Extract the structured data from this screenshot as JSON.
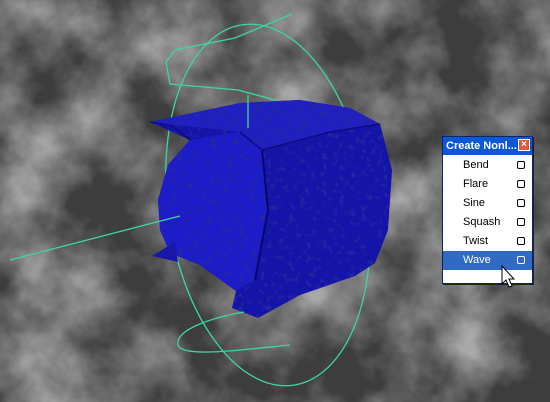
{
  "menu": {
    "title": "Create Nonl...",
    "close_icon": "close-icon",
    "items": [
      {
        "label": "Bend",
        "option_icon": "option-box-icon"
      },
      {
        "label": "Flare",
        "option_icon": "option-box-icon"
      },
      {
        "label": "Sine",
        "option_icon": "option-box-icon"
      },
      {
        "label": "Squash",
        "option_icon": "option-box-icon"
      },
      {
        "label": "Twist",
        "option_icon": "option-box-icon"
      },
      {
        "label": "Wave",
        "option_icon": "option-box-icon",
        "selected": true
      }
    ]
  },
  "colors": {
    "mesh": "#1010b0",
    "deformer_handle": "#3ed6a0",
    "title_bar": "#0a58d8",
    "selection": "#316ac5"
  }
}
